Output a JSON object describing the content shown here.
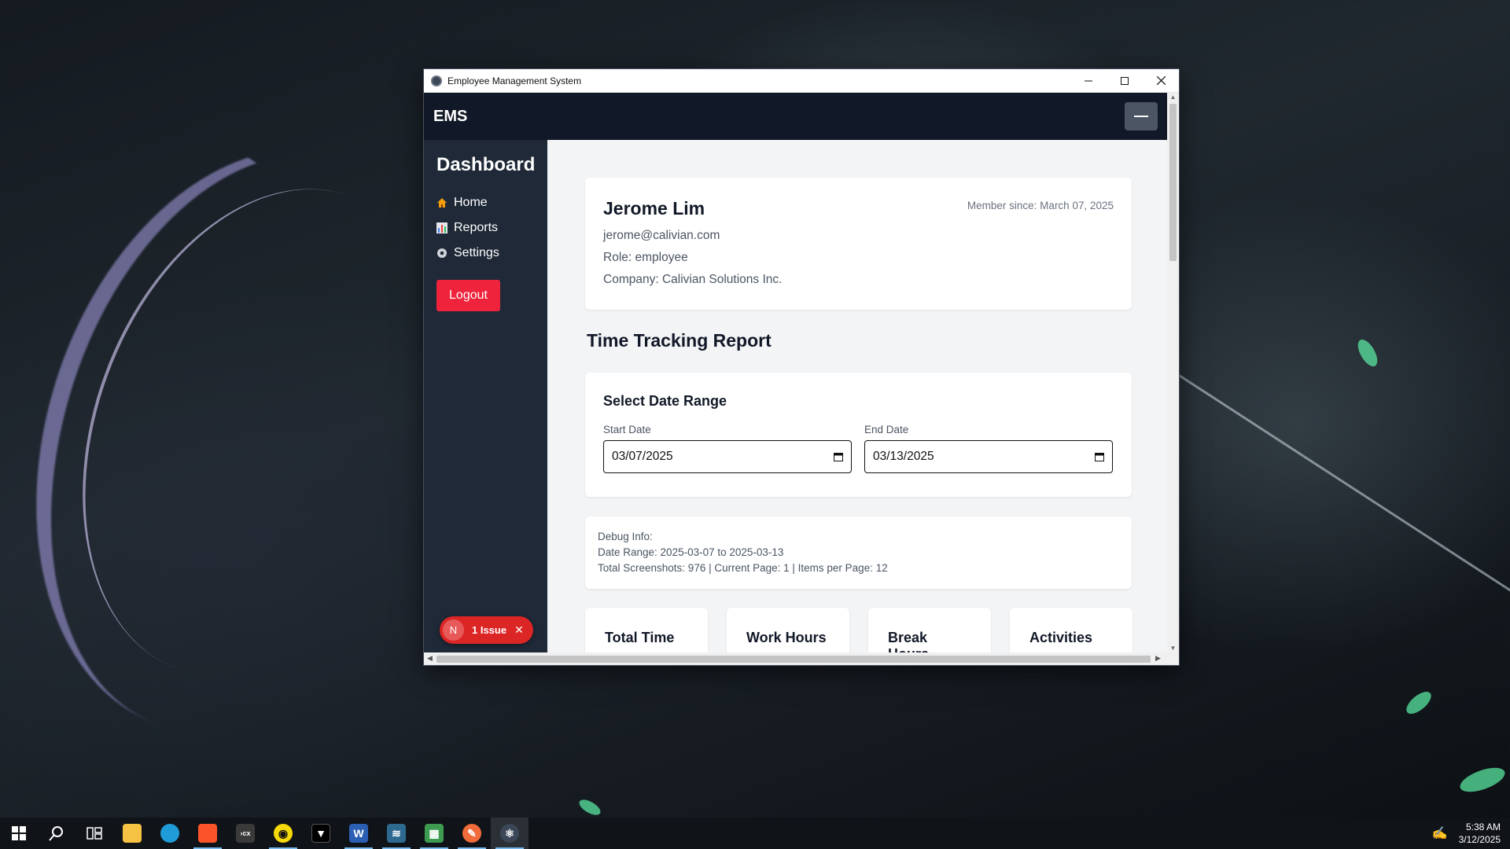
{
  "window": {
    "title": "Employee Management System"
  },
  "app": {
    "brand": "EMS"
  },
  "sidebar": {
    "heading": "Dashboard",
    "items": [
      {
        "label": "Home",
        "icon": "home-icon"
      },
      {
        "label": "Reports",
        "icon": "chart-icon"
      },
      {
        "label": "Settings",
        "icon": "gear-icon"
      }
    ],
    "logout_label": "Logout"
  },
  "issue_badge": {
    "avatar_letter": "N",
    "label": "1 Issue",
    "close": "✕"
  },
  "profile": {
    "name": "Jerome Lim",
    "email": "jerome@calivian.com",
    "role": "Role: employee",
    "company": "Company: Calivian Solutions Inc.",
    "member_since": "Member since: March 07, 2025"
  },
  "report": {
    "title": "Time Tracking Report",
    "date_range": {
      "heading": "Select Date Range",
      "start_label": "Start Date",
      "start_value": "03/07/2025",
      "end_label": "End Date",
      "end_value": "03/13/2025"
    },
    "debug": {
      "line1": "Debug Info:",
      "line2": "Date Range: 2025-03-07 to 2025-03-13",
      "line3": "Total Screenshots: 976 | Current Page: 1 | Items per Page: 12"
    },
    "stats": [
      "Total Time",
      "Work Hours",
      "Break Hours",
      "Activities"
    ]
  },
  "taskbar": {
    "apps": [
      "start",
      "search",
      "task-view",
      "file-explorer",
      "edge",
      "brave",
      "terminal",
      "app-yellow",
      "app-black",
      "word",
      "mysql-workbench",
      "excel",
      "postman",
      "electron"
    ],
    "time": "5:38 AM",
    "date": "3/12/2025"
  },
  "colors": {
    "accent_red": "#ef233c",
    "nav_dark": "#111827",
    "sidebar_dark": "#1f2937"
  }
}
